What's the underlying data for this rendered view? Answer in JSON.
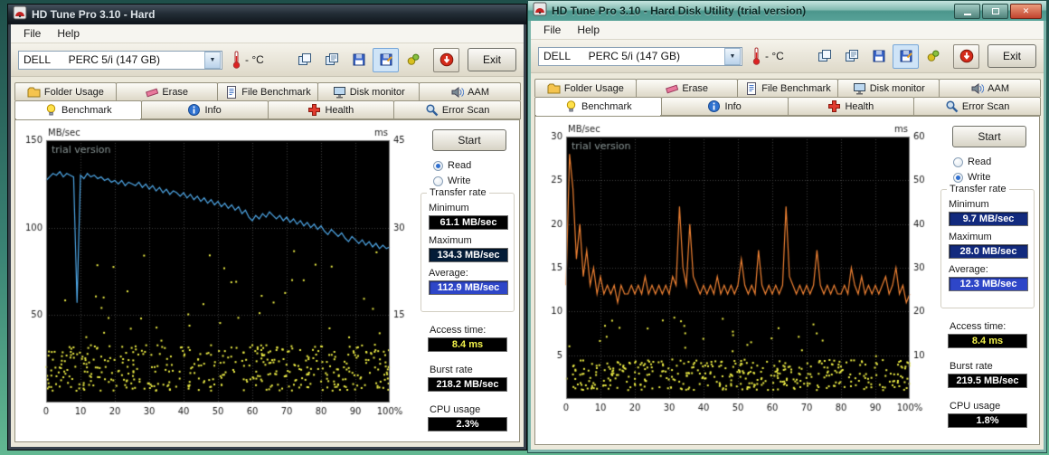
{
  "desktop": {
    "background": "#2e6b5e"
  },
  "windows": [
    {
      "name": "left-window",
      "active": false,
      "title": "HD Tune Pro 3.10 - Hard",
      "menu": [
        "File",
        "Help"
      ],
      "drive": "DELL      PERC 5/i (147 GB)",
      "temperature": "- °C",
      "toolbar_icons": [
        "copy-image-icon",
        "copy-text-icon",
        "save-image-icon",
        "save-text-icon",
        "export-gears-icon",
        "download-icon"
      ],
      "exit_label": "Exit",
      "tabs_row1": [
        {
          "label": "Folder Usage",
          "icon": "folder-icon"
        },
        {
          "label": "Erase",
          "icon": "eraser-icon"
        },
        {
          "label": "File Benchmark",
          "icon": "file-benchmark-icon"
        },
        {
          "label": "Disk monitor",
          "icon": "disk-monitor-icon"
        },
        {
          "label": "AAM",
          "icon": "speaker-icon"
        }
      ],
      "tabs_row2": [
        {
          "label": "Benchmark",
          "icon": "bulb-icon",
          "active": true
        },
        {
          "label": "Info",
          "icon": "info-icon"
        },
        {
          "label": "Health",
          "icon": "health-icon"
        },
        {
          "label": "Error Scan",
          "icon": "magnifier-icon"
        }
      ],
      "start_label": "Start",
      "radios": {
        "read_label": "Read",
        "write_label": "Write",
        "selected": "read"
      },
      "transfer_rate": {
        "legend": "Transfer rate",
        "minimum_label": "Minimum",
        "minimum": "61.1 MB/sec",
        "maximum_label": "Maximum",
        "maximum": "134.3 MB/sec",
        "average_label": "Average:",
        "average": "112.9 MB/sec"
      },
      "access_time_label": "Access time:",
      "access_time": "8.4 ms",
      "burst_rate_label": "Burst rate",
      "burst_rate": "218.2 MB/sec",
      "cpu_usage_label": "CPU usage",
      "cpu_usage": "2.3%",
      "styles": {
        "minimum": {
          "bg": "#000000",
          "fg": "#ffffff"
        },
        "maximum": {
          "bg": "#031c38",
          "fg": "#ffffff"
        },
        "average": {
          "bg": "#2e46c8",
          "fg": "#ffffff"
        },
        "access": {
          "bg": "#000000",
          "fg": "#f2f24a"
        },
        "burst": {
          "bg": "#000000",
          "fg": "#ffffff"
        },
        "cpu": {
          "bg": "#000000",
          "fg": "#ffffff"
        }
      }
    },
    {
      "name": "right-window",
      "active": true,
      "title": "HD Tune Pro 3.10 - Hard Disk Utility (trial version)",
      "menu": [
        "File",
        "Help"
      ],
      "drive": "DELL      PERC 5/i (147 GB)",
      "temperature": "- °C",
      "toolbar_icons": [
        "copy-image-icon",
        "copy-text-icon",
        "save-image-icon",
        "save-text-icon",
        "export-gears-icon",
        "download-icon"
      ],
      "exit_label": "Exit",
      "tabs_row1": [
        {
          "label": "Folder Usage",
          "icon": "folder-icon"
        },
        {
          "label": "Erase",
          "icon": "eraser-icon"
        },
        {
          "label": "File Benchmark",
          "icon": "file-benchmark-icon"
        },
        {
          "label": "Disk monitor",
          "icon": "disk-monitor-icon"
        },
        {
          "label": "AAM",
          "icon": "speaker-icon"
        }
      ],
      "tabs_row2": [
        {
          "label": "Benchmark",
          "icon": "bulb-icon",
          "active": true
        },
        {
          "label": "Info",
          "icon": "info-icon"
        },
        {
          "label": "Health",
          "icon": "health-icon"
        },
        {
          "label": "Error Scan",
          "icon": "magnifier-icon"
        }
      ],
      "start_label": "Start",
      "radios": {
        "read_label": "Read",
        "write_label": "Write",
        "selected": "write"
      },
      "transfer_rate": {
        "legend": "Transfer rate",
        "minimum_label": "Minimum",
        "minimum": "9.7 MB/sec",
        "maximum_label": "Maximum",
        "maximum": "28.0 MB/sec",
        "average_label": "Average:",
        "average": "12.3 MB/sec"
      },
      "access_time_label": "Access time:",
      "access_time": "8.4 ms",
      "burst_rate_label": "Burst rate",
      "burst_rate": "219.5 MB/sec",
      "cpu_usage_label": "CPU usage",
      "cpu_usage": "1.8%",
      "styles": {
        "minimum": {
          "bg": "#122a7e",
          "fg": "#ffffff"
        },
        "maximum": {
          "bg": "#122a7e",
          "fg": "#ffffff"
        },
        "average": {
          "bg": "#2e46c8",
          "fg": "#ffffff"
        },
        "access": {
          "bg": "#000000",
          "fg": "#f2f24a"
        },
        "burst": {
          "bg": "#000000",
          "fg": "#ffffff"
        },
        "cpu": {
          "bg": "#000000",
          "fg": "#ffffff"
        }
      }
    }
  ],
  "chart_data": [
    {
      "type": "line",
      "title": "trial version",
      "x_ticks": [
        0,
        10,
        20,
        30,
        40,
        50,
        60,
        70,
        80,
        90,
        100
      ],
      "x_last_label": "100%",
      "left_axis": {
        "label": "MB/sec",
        "min": 0,
        "max": 150,
        "ticks": [
          50,
          100,
          150
        ]
      },
      "right_axis": {
        "label": "ms",
        "min": 0,
        "max": 45,
        "ticks": [
          15,
          30,
          45
        ]
      },
      "plot_bg": "#000000",
      "grid_color": "#3f3f3f",
      "border_color": "#787878",
      "text_color": "#1c1c1c",
      "trial_color": "#8a9696",
      "series": [
        {
          "name": "read-transfer-rate",
          "type": "line",
          "axis": "left",
          "color": "#4fa8e8",
          "x_step": 1,
          "values": [
            127,
            129,
            131,
            130,
            132,
            129,
            131,
            130,
            129,
            57,
            130,
            128,
            131,
            129,
            130,
            128,
            129,
            127,
            128,
            126,
            127,
            125,
            127,
            124,
            126,
            125,
            124,
            126,
            123,
            125,
            122,
            124,
            121,
            123,
            120,
            122,
            119,
            121,
            120,
            118,
            120,
            117,
            119,
            116,
            118,
            115,
            117,
            114,
            116,
            113,
            115,
            112,
            114,
            111,
            113,
            110,
            112,
            108,
            110,
            106,
            104,
            107,
            105,
            108,
            106,
            109,
            107,
            105,
            107,
            104,
            106,
            103,
            105,
            102,
            104,
            101,
            103,
            100,
            102,
            99,
            101,
            98,
            96,
            99,
            97,
            95,
            97,
            94,
            92,
            95,
            93,
            91,
            93,
            90,
            92,
            89,
            91,
            88,
            90,
            88,
            89
          ]
        },
        {
          "name": "access-time-dots",
          "type": "scatter",
          "axis": "right",
          "color": "#eded45",
          "count": 480,
          "band": [
            2,
            10
          ],
          "outliers": [
            10,
            26
          ],
          "outlier_ratio": 0.08,
          "seed": 1234
        }
      ]
    },
    {
      "type": "line",
      "title": "trial version",
      "x_ticks": [
        0,
        10,
        20,
        30,
        40,
        50,
        60,
        70,
        80,
        90,
        100
      ],
      "x_last_label": "100%",
      "left_axis": {
        "label": "MB/sec",
        "min": 0,
        "max": 30,
        "ticks": [
          5,
          10,
          15,
          20,
          25,
          30
        ]
      },
      "right_axis": {
        "label": "ms",
        "min": 0,
        "max": 60,
        "ticks": [
          10,
          20,
          30,
          40,
          50,
          60
        ]
      },
      "plot_bg": "#000000",
      "grid_color": "#3f3f3f",
      "border_color": "#787878",
      "text_color": "#1c1c1c",
      "trial_color": "#8a9696",
      "series": [
        {
          "name": "write-transfer-rate",
          "type": "line",
          "axis": "left",
          "color": "#f08233",
          "x_step": 1,
          "values": [
            13,
            28,
            24,
            16,
            20,
            14,
            17,
            13,
            15,
            12,
            14,
            12,
            13,
            12,
            13,
            11,
            13,
            12,
            12,
            13,
            12,
            13,
            12,
            14,
            12,
            13,
            12,
            13,
            12,
            13,
            12,
            14,
            13,
            22,
            15,
            13,
            20,
            14,
            13,
            12,
            13,
            12,
            13,
            12,
            14,
            12,
            13,
            12,
            13,
            12,
            13,
            16,
            13,
            12,
            13,
            12,
            17,
            13,
            12,
            13,
            12,
            13,
            12,
            13,
            22,
            14,
            13,
            12,
            13,
            12,
            13,
            12,
            13,
            17,
            13,
            12,
            13,
            12,
            13,
            12,
            12,
            13,
            12,
            15,
            13,
            12,
            14,
            12,
            13,
            12,
            13,
            12,
            13,
            14,
            12,
            13,
            15,
            12,
            13,
            11,
            12
          ]
        },
        {
          "name": "access-time-dots",
          "type": "scatter",
          "axis": "right",
          "color": "#eded45",
          "count": 430,
          "band": [
            2,
            9
          ],
          "outliers": [
            9,
            20
          ],
          "outlier_ratio": 0.06,
          "seed": 777
        }
      ]
    }
  ]
}
